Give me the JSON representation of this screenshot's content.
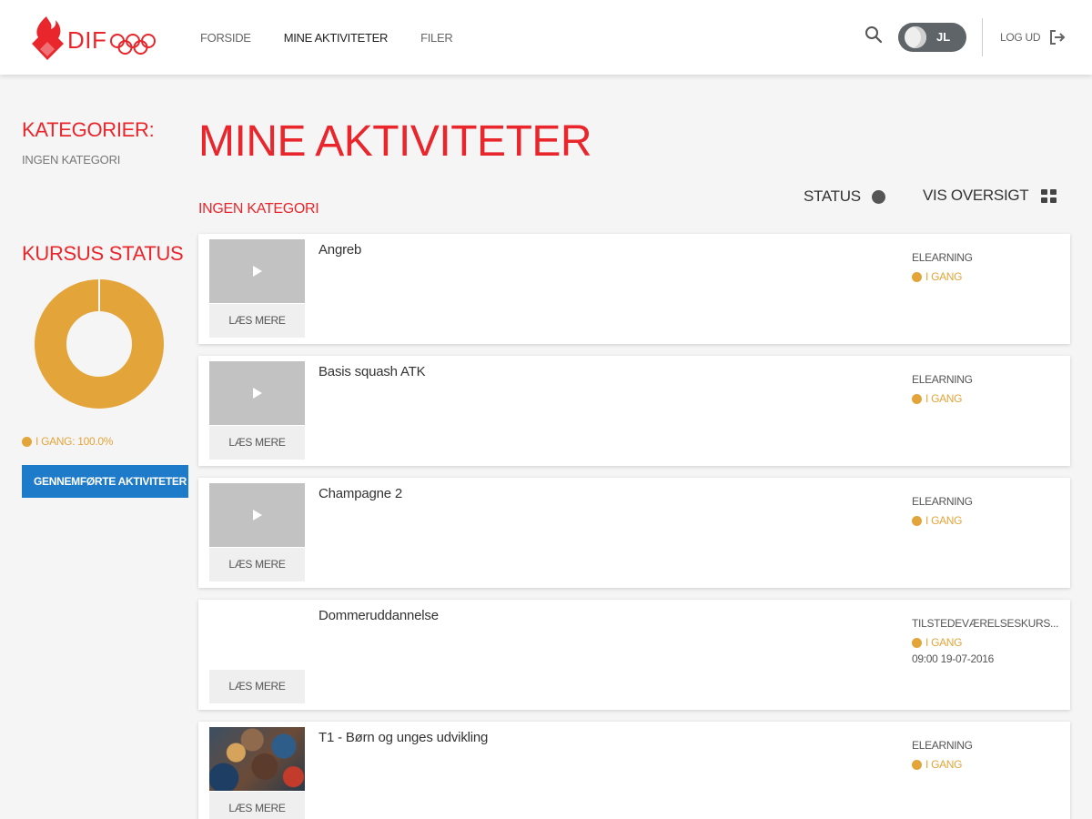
{
  "header": {
    "logo_text": "DIF",
    "nav": [
      {
        "label": "FORSIDE"
      },
      {
        "label": "MINE AKTIVITETER"
      },
      {
        "label": "FILER"
      }
    ],
    "user_initials": "JL",
    "logout_label": "LOG UD"
  },
  "sidebar": {
    "categories_heading": "KATEGORIER:",
    "category_value": "INGEN KATEGORI",
    "status_heading": "KURSUS STATUS",
    "legend_label": "I GANG: 100.0%",
    "completed_button": "GENNEMFØRTE AKTIVITETER"
  },
  "chart_data": {
    "type": "pie",
    "categories": [
      "I GANG"
    ],
    "values": [
      100.0
    ],
    "title": "KURSUS STATUS",
    "colors": [
      "#e3a43a"
    ]
  },
  "main": {
    "title": "MINE AKTIVITETER",
    "status_label": "STATUS",
    "overview_label": "VIS OVERSIGT",
    "category_heading": "INGEN KATEGORI",
    "activities": [
      {
        "title": "Angreb",
        "type": "ELEARNING",
        "status": "I GANG",
        "date": "",
        "read_more": "LÆS MERE"
      },
      {
        "title": "Basis squash ATK",
        "type": "ELEARNING",
        "status": "I GANG",
        "date": "",
        "read_more": "LÆS MERE"
      },
      {
        "title": "Champagne 2",
        "type": "ELEARNING",
        "status": "I GANG",
        "date": "",
        "read_more": "LÆS MERE"
      },
      {
        "title": "Dommeruddannelse",
        "type": "TILSTEDEVÆRELSESKURS...",
        "status": "I GANG",
        "date": "09:00 19-07-2016",
        "read_more": "LÆS MERE"
      },
      {
        "title": "T1 - Børn og unges udvikling",
        "type": "ELEARNING",
        "status": "I GANG",
        "date": "",
        "read_more": "LÆS MERE"
      }
    ]
  },
  "colors": {
    "brand_red": "#e8262c",
    "in_progress": "#e3a43a",
    "primary_button": "#1e7bc9"
  }
}
